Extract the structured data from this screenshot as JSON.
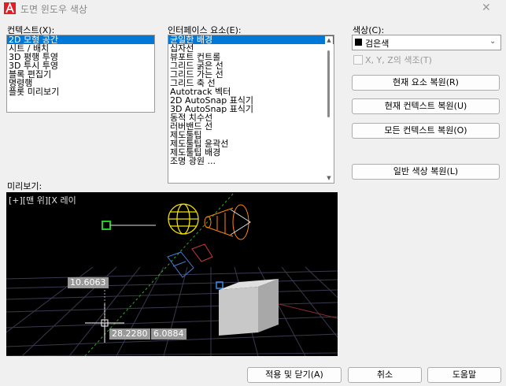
{
  "window": {
    "title": "도면 윈도우 색상"
  },
  "context": {
    "label": "컨텍스트(X):",
    "items": [
      "2D 모형 공간",
      "시트 / 배치",
      "3D 평행 투영",
      "3D 투시 투영",
      "블록 편집기",
      "명령행",
      "플롯 미리보기"
    ],
    "selected_index": 0
  },
  "interface": {
    "label": "인터페이스 요소(E):",
    "items": [
      "균일한 배경",
      "십자선",
      "뷰포트 컨트롤",
      "그리드 굵은 선",
      "그리드 가는 선",
      "그리드 축 선",
      "Autotrack 벡터",
      "2D AutoSnap 표식기",
      "3D AutoSnap 표식기",
      "동적 치수선",
      "러버밴드 선",
      "제도툴팁",
      "제도툴팁 윤곽선",
      "제도툴팁 배경",
      "조명 광원 ..."
    ],
    "selected_index": 0
  },
  "color": {
    "label": "색상(C):",
    "value": "검은색",
    "swatch": "#000000",
    "tint_label": "X, Y, Z의 색조(T)"
  },
  "buttons": {
    "restore_current_element": "현재 요소 복원(R)",
    "restore_current_context": "현재 컨텍스트 복원(U)",
    "restore_all_contexts": "모든 컨텍스트 복원(O)",
    "restore_classic_colors": "일반 색상 복원(L)",
    "apply_close": "적용 및 닫기(A)",
    "cancel": "취소",
    "help": "도움말"
  },
  "preview": {
    "label": "미리보기:",
    "viewport_label": "[+][맨 위][X 레이",
    "dims": {
      "d1": "10.6063",
      "d2": "28.2280",
      "d3": "6.0884"
    }
  },
  "colors": {
    "accent": "#0078d7",
    "preview_bg": "#000000",
    "grid": "#3a3a50",
    "dim_box": "#999999"
  }
}
